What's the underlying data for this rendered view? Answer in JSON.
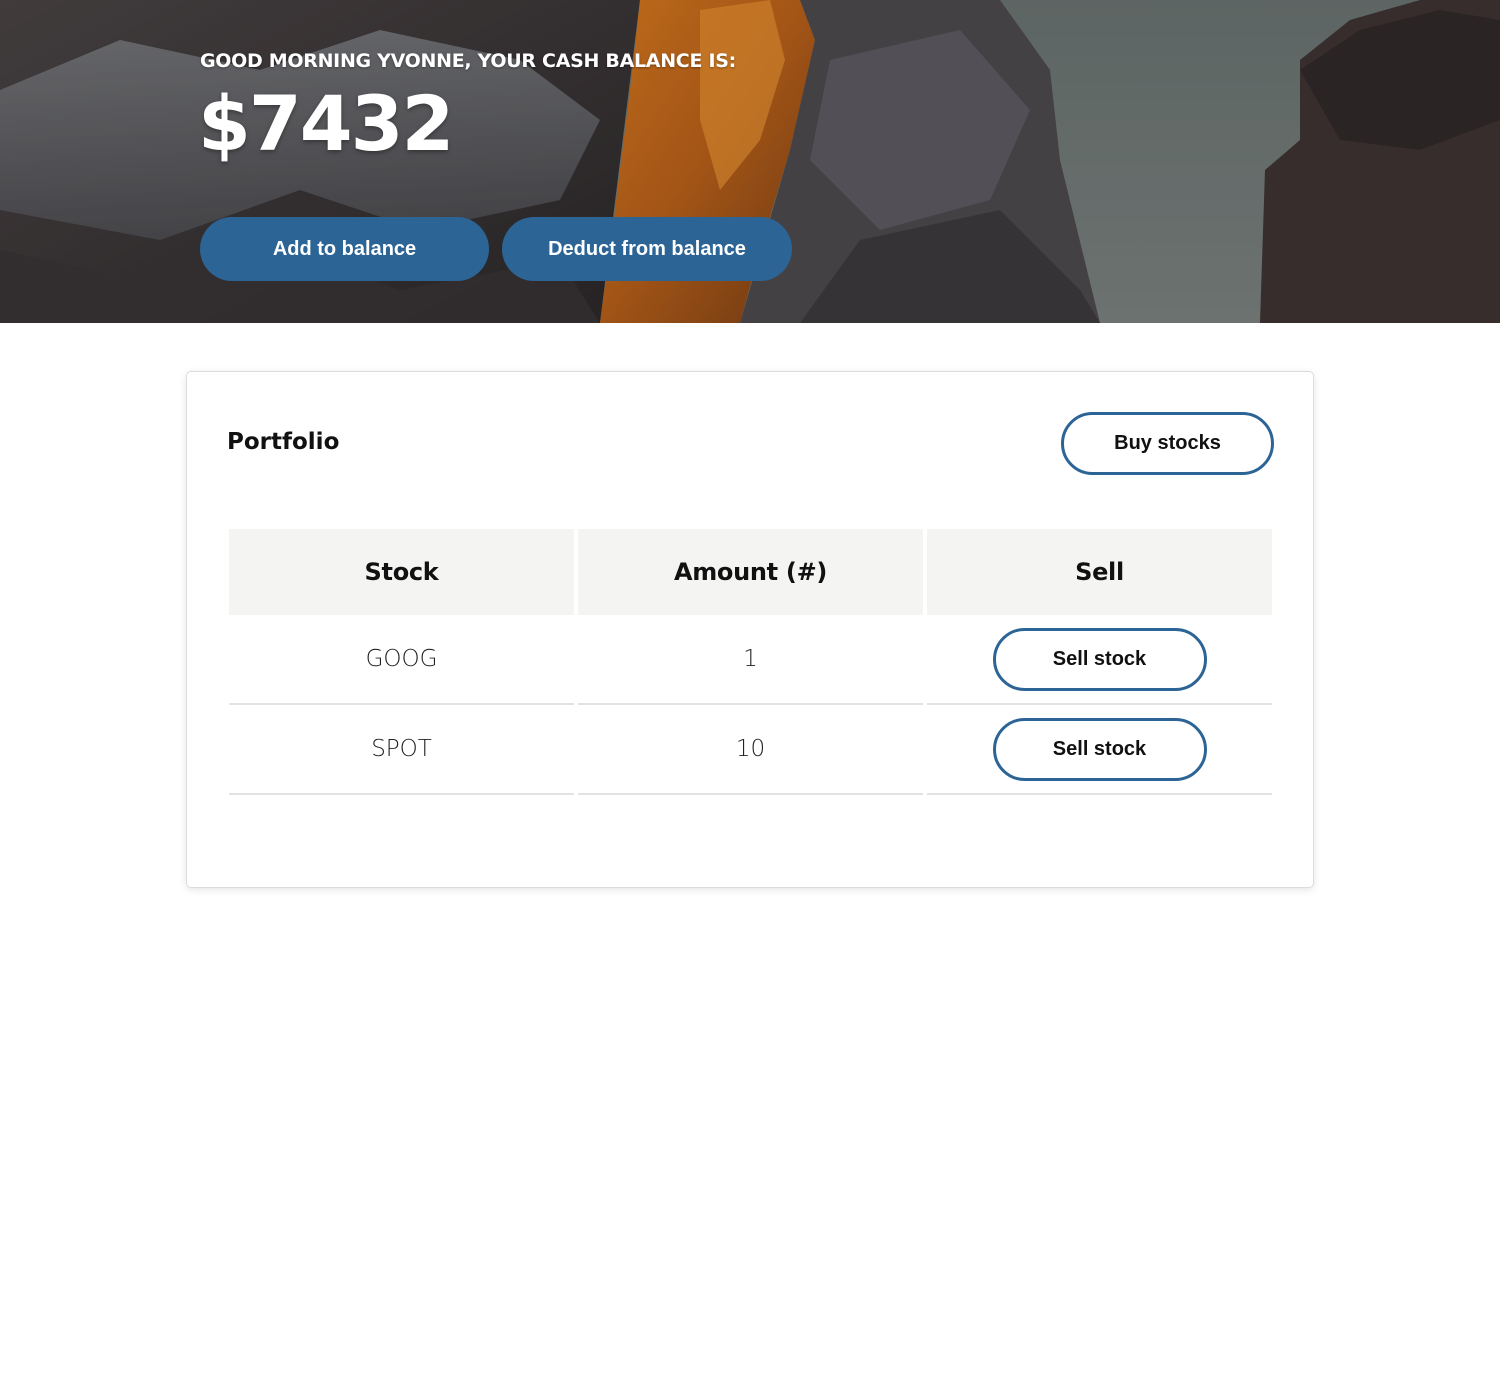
{
  "hero": {
    "greeting": "GOOD MORNING YVONNE, YOUR CASH BALANCE IS:",
    "balance": "$7432",
    "add_label": "Add to balance",
    "deduct_label": "Deduct from balance",
    "background": "mountain-cliff-sunset-photo",
    "accent_color": "#2c6496"
  },
  "portfolio": {
    "title": "Portfolio",
    "buy_label": "Buy stocks",
    "columns": [
      "Stock",
      "Amount (#)",
      "Sell"
    ],
    "rows": [
      {
        "stock": "GOOG",
        "amount": "1",
        "action": "Sell stock"
      },
      {
        "stock": "SPOT",
        "amount": "10",
        "action": "Sell stock"
      }
    ]
  }
}
